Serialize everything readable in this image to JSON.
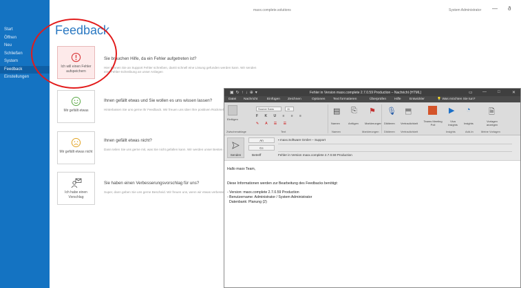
{
  "topbar": {
    "title": "maxx.complete.solutions",
    "user": "System Administrator",
    "minimize": "—",
    "pin": "ð"
  },
  "sidebar": {
    "items": [
      {
        "label": "Start",
        "active": false
      },
      {
        "label": "Öffnen",
        "active": false
      },
      {
        "label": "Neu",
        "active": false
      },
      {
        "label": "Schließen",
        "active": false
      },
      {
        "label": "System",
        "active": false
      },
      {
        "label": "Feedback",
        "active": true
      },
      {
        "label": "Einstellungen",
        "active": false
      }
    ]
  },
  "page": {
    "title": "Feedback"
  },
  "cards": [
    {
      "label": "Ich will einen Fehler aufspeichern",
      "icon": "warning-icon"
    },
    {
      "label": "Mir gefällt etwas",
      "icon": "smiley-happy-icon"
    },
    {
      "label": "Mir gefällt etwas nicht",
      "icon": "smiley-sad-icon"
    },
    {
      "label": "Ich habe einen Vorschlag",
      "icon": "mail-person-icon"
    }
  ],
  "questions": [
    {
      "title": "Sie brauchen Hilfe, da ein Fehler aufgetreten ist?",
      "desc": "Hier können Sie an Support Fehler schreiben, damit schnell eine Lösung gefunden werden kann. Wir senden eine Fehler-Schreibung an unser Anliegen"
    },
    {
      "title": "Ihnen gefällt etwas und Sie wollen es uns wissen lassen?",
      "desc": "Hinterlassen Sie uns gerne Ihr Feedback. Wir freuen uns über Ihre positiven Rückmeldungen!"
    },
    {
      "title": "Ihnen gefällt etwas nicht?",
      "desc": "Dann teilen Sie uns gerne mit, was Sie nicht gefallen kann. Wir werden unser Bestes geben, das zu verbessern."
    },
    {
      "title": "Sie haben einen Verbesserungsvorschlag für uns?",
      "desc": "Super, dann geben Sie uns gerne Bescheid. Wir freuen uns, wenn wir etwas verbessern können!"
    }
  ],
  "outlook": {
    "title": "Fehler in Version maxx.complete 2.7.0.59 Production – Nachricht (HTML)",
    "controls": [
      "▭",
      "—",
      "□",
      "✕"
    ],
    "menu": [
      "Datei",
      "Nachricht",
      "Einfügen",
      "Zeichnen",
      "Optionen",
      "Text formatieren",
      "Überprüfen",
      "Hilfe",
      "Entwickler",
      "Was möchten Sie tun?"
    ],
    "ribbon": {
      "paste": "Einfügen",
      "font_name": "Source Sans",
      "font_size": "11",
      "names": "Namen",
      "attach": "Anfügen",
      "signature": "Markierungen",
      "dictate": "Diktieren",
      "sensitivity": "Vertraulichkeit",
      "teams": "Teams Meeting Poll",
      "viva": "Viva Insights",
      "insights": "Insights",
      "templates": "Vorlagen anzeigen",
      "groups": [
        "Zwischenablage",
        "Text",
        "Namen",
        "Markierungen",
        "Diktieren",
        "Vertraulichkeit",
        "Insights",
        "Add-In",
        "Meine Vorlagen"
      ]
    },
    "header": {
      "send": "Senden",
      "to_label": "An",
      "cc_label": "Cc",
      "subject_label": "Betreff",
      "to_value": "maxx.Software GmbH – Support",
      "subject_value": "Fehler in Version maxx.complete 2.7.0.59 Production"
    },
    "body": {
      "greeting": "Hallo maxx Team,",
      "intro": "Diese Informationen werden zur Bearbeitung des Feedbacks benötigt:",
      "lines": [
        "- Version: maxx.complete 2.7.0.59 Production",
        "- Benutzername: Administrator / System Administrator",
        "  Datenbank: Planung (2)"
      ]
    }
  },
  "colors": {
    "sidebar": "#1473c2",
    "accent": "#2b79c2",
    "highlight": "#e21b1b"
  }
}
